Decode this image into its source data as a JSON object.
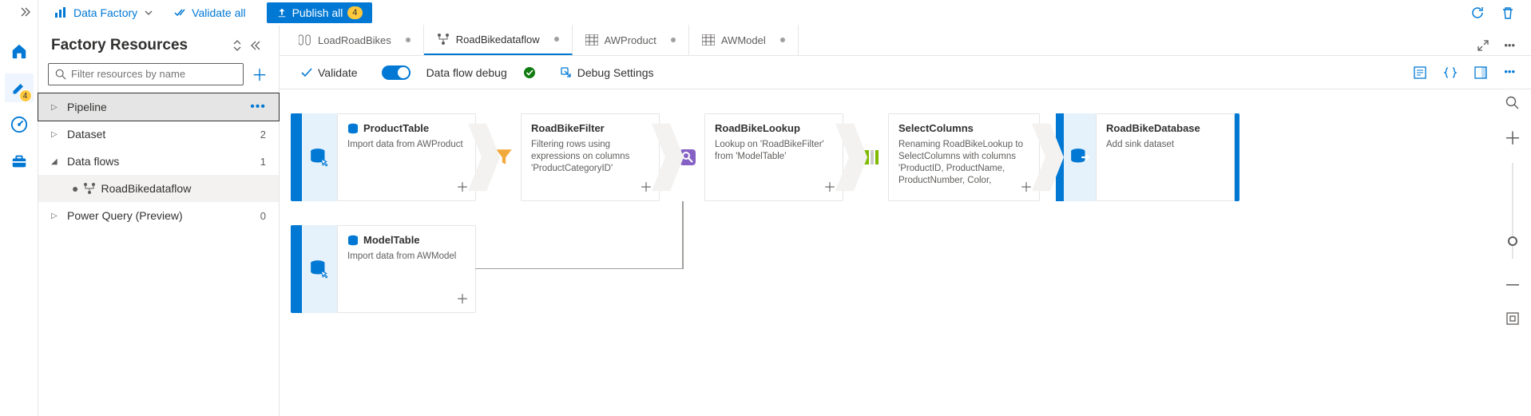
{
  "topbar": {
    "workspace": "Data Factory",
    "validate_all": "Validate all",
    "publish_all": "Publish all",
    "publish_count": "4"
  },
  "rail": {
    "edit_badge": "4"
  },
  "resources": {
    "title": "Factory Resources",
    "filter_placeholder": "Filter resources by name",
    "tree": {
      "pipeline": {
        "label": "Pipeline",
        "count": ""
      },
      "dataset": {
        "label": "Dataset",
        "count": "2"
      },
      "dataflows": {
        "label": "Data flows",
        "count": "1",
        "child": "RoadBikedataflow"
      },
      "powerquery": {
        "label": "Power Query (Preview)",
        "count": "0"
      }
    }
  },
  "tabs": {
    "t0": "LoadRoadBikes",
    "t1": "RoadBikedataflow",
    "t2": "AWProduct",
    "t3": "AWModel"
  },
  "flowbar": {
    "validate": "Validate",
    "debug_label": "Data flow debug",
    "debug_settings": "Debug Settings"
  },
  "nodes": {
    "product": {
      "title": "ProductTable",
      "desc": "Import data from AWProduct"
    },
    "model": {
      "title": "ModelTable",
      "desc": "Import data from AWModel"
    },
    "filter": {
      "title": "RoadBikeFilter",
      "desc": "Filtering rows using expressions on columns 'ProductCategoryID'"
    },
    "lookup": {
      "title": "RoadBikeLookup",
      "desc": "Lookup on 'RoadBikeFilter' from 'ModelTable'"
    },
    "select": {
      "title": "SelectColumns",
      "desc": "Renaming RoadBikeLookup to SelectColumns with columns 'ProductID, ProductName, ProductNumber, Color,"
    },
    "sink": {
      "title": "RoadBikeDatabase",
      "desc": "Add sink dataset"
    }
  }
}
